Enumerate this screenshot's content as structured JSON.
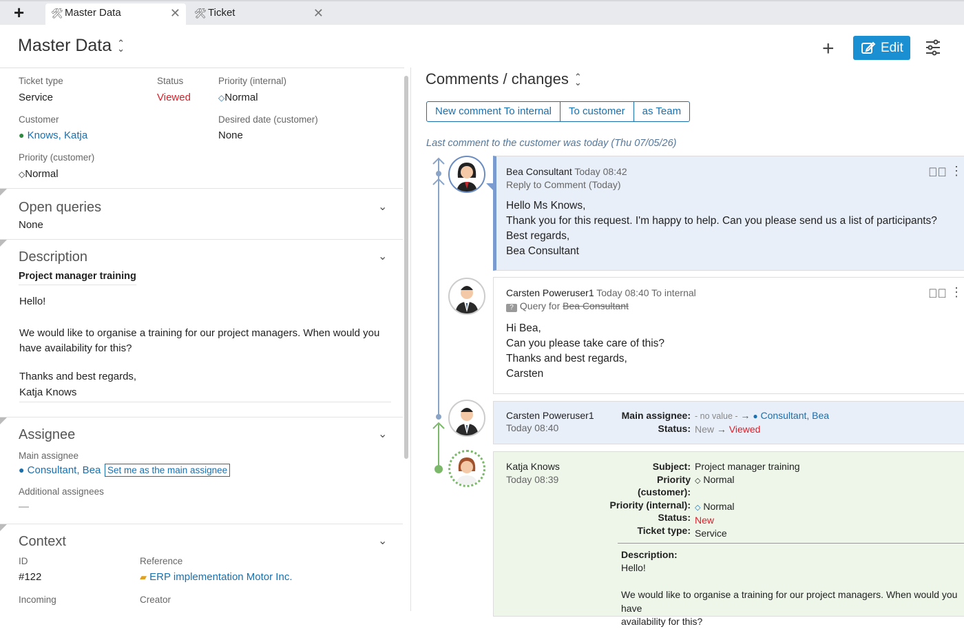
{
  "tabs": [
    {
      "label": "Master Data",
      "icon": "tools-icon"
    },
    {
      "label": "Ticket",
      "icon": "tools-icon"
    }
  ],
  "header": {
    "title": "Master Data",
    "edit_label": "Edit"
  },
  "details": {
    "ticket_type_label": "Ticket type",
    "ticket_type": "Service",
    "status_label": "Status",
    "status": "Viewed",
    "priority_internal_label": "Priority (internal)",
    "priority_internal": "Normal",
    "customer_label": "Customer",
    "customer": "Knows, Katja",
    "desired_date_label": "Desired date (customer)",
    "desired_date": "None",
    "priority_customer_label": "Priority (customer)",
    "priority_customer": "Normal"
  },
  "open_queries": {
    "title": "Open queries",
    "value": "None"
  },
  "description": {
    "title": "Description",
    "subject": "Project manager training",
    "lines": [
      "Hello!",
      "We would like to organise a training for our project managers. When would you have availability for this?",
      "Thanks and best regards,",
      "Katja Knows"
    ]
  },
  "assignee": {
    "title": "Assignee",
    "main_label": "Main assignee",
    "main": "Consultant, Bea",
    "set_me": "Set me as the main assignee",
    "additional_label": "Additional assignees",
    "additional": "—"
  },
  "context": {
    "title": "Context",
    "id_label": "ID",
    "id": "#122",
    "reference_label": "Reference",
    "reference": "ERP implementation Motor Inc.",
    "incoming_label": "Incoming",
    "creator_label": "Creator"
  },
  "comments": {
    "title": "Comments / changes",
    "buttons": [
      "New comment To internal",
      "To customer",
      "as Team"
    ],
    "last_comment": "Last comment to the customer was today (Thu 07/05/26)",
    "c1": {
      "author": "Bea Consultant",
      "time": "Today 08:42",
      "sub": "Reply to Comment (Today)",
      "lines": [
        "Hello Ms Knows,",
        "Thank you for this request. I'm happy to help. Can you please send us a list of participants?",
        "Best regards,",
        "Bea Consultant"
      ]
    },
    "c2": {
      "author": "Carsten Poweruser1",
      "time": "Today 08:40 To internal",
      "query_for": "Query for",
      "query_target": "Bea Consultant",
      "lines": [
        "Hi Bea,",
        "Can you please take care of this?",
        "Thanks and best regards,",
        "Carsten"
      ]
    },
    "c3": {
      "author": "Carsten Poweruser1",
      "time": "Today 08:40",
      "k1": "Main assignee:",
      "v1_old": "- no value -",
      "v1_new": "Consultant, Bea",
      "k2": "Status:",
      "v2_old": "New",
      "v2_new": "Viewed"
    },
    "c4": {
      "author": "Katja Knows",
      "time": "Today 08:39",
      "subject_k": "Subject:",
      "subject_v": "Project manager training",
      "pc_k1": "Priority",
      "pc_k2": "(customer):",
      "pc_v": "Normal",
      "pi_k": "Priority (internal):",
      "pi_v": "Normal",
      "status_k": "Status:",
      "status_v": "New",
      "type_k": "Ticket type:",
      "type_v": "Service",
      "desc_k": "Description:",
      "desc_lines": [
        "Hello!",
        "We would like to organise a training for our project managers. When would you have",
        "availability for this?"
      ]
    }
  },
  "colors": {
    "accent": "#1a8fd1",
    "link": "#1a6fae",
    "status_red": "#d9202a",
    "card_blue": "#e8eff9",
    "card_green": "#edf6e9"
  }
}
